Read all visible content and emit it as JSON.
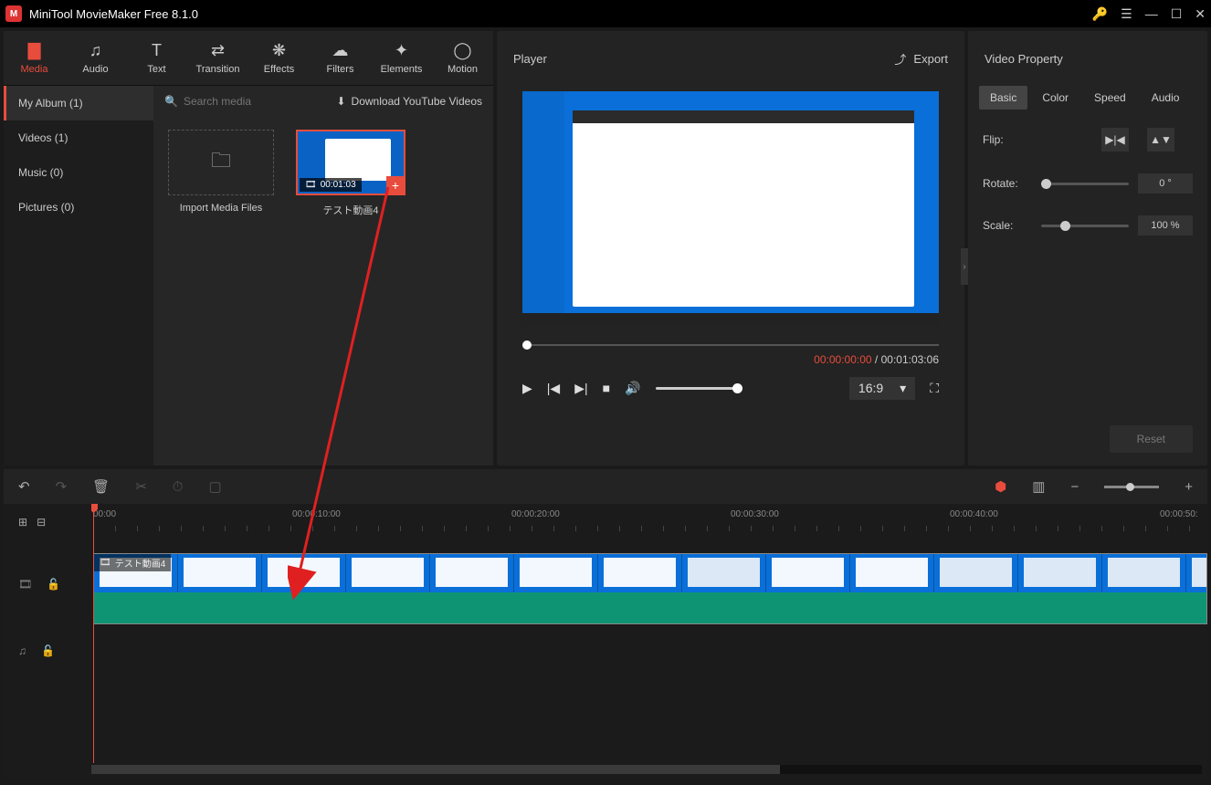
{
  "app": {
    "title": "MiniTool MovieMaker Free 8.1.0"
  },
  "ribbon": [
    {
      "label": "Media",
      "icon": "📁"
    },
    {
      "label": "Audio",
      "icon": "♫"
    },
    {
      "label": "Text",
      "icon": "T"
    },
    {
      "label": "Transition",
      "icon": "⇄"
    },
    {
      "label": "Effects",
      "icon": "✦"
    },
    {
      "label": "Filters",
      "icon": "☁"
    },
    {
      "label": "Elements",
      "icon": "✧"
    },
    {
      "label": "Motion",
      "icon": "◯"
    }
  ],
  "sidenav": {
    "items": [
      {
        "label": "My Album (1)"
      },
      {
        "label": "Videos (1)"
      },
      {
        "label": "Music (0)"
      },
      {
        "label": "Pictures (0)"
      }
    ]
  },
  "media": {
    "search_placeholder": "Search media",
    "download_label": "Download YouTube Videos",
    "import_label": "Import Media Files",
    "clip": {
      "name": "テスト動画4",
      "duration": "00:01:03"
    }
  },
  "player": {
    "title": "Player",
    "export_label": "Export",
    "current_time": "00:00:00:00",
    "total_time": "00:01:03:06",
    "ratio": "16:9"
  },
  "props": {
    "title": "Video Property",
    "tabs": [
      "Basic",
      "Color",
      "Speed",
      "Audio"
    ],
    "flip_label": "Flip:",
    "rotate_label": "Rotate:",
    "rotate_value": "0 °",
    "scale_label": "Scale:",
    "scale_value": "100 %",
    "reset_label": "Reset"
  },
  "timeline": {
    "ticks": [
      "00:00",
      "00:00:10:00",
      "00:00:20:00",
      "00:00:30:00",
      "00:00:40:00",
      "00:00:50:"
    ],
    "clip_label": "テスト動画4"
  }
}
